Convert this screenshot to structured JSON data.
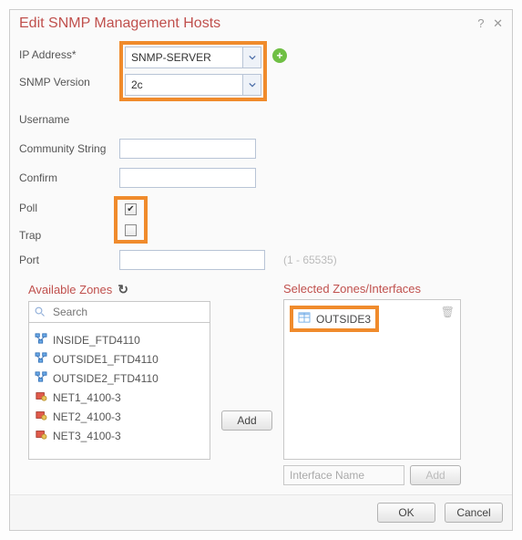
{
  "dialog": {
    "title": "Edit SNMP Management Hosts"
  },
  "form": {
    "ip_label": "IP Address*",
    "ip_value": "SNMP-SERVER",
    "version_label": "SNMP Version",
    "version_value": "2c",
    "username_label": "Username",
    "community_label": "Community String",
    "confirm_label": "Confirm",
    "poll_label": "Poll",
    "poll_checked": true,
    "trap_label": "Trap",
    "trap_checked": false,
    "port_label": "Port",
    "port_hint": "(1 - 65535)"
  },
  "zones": {
    "available_title": "Available Zones",
    "search_placeholder": "Search",
    "items": [
      {
        "name": "INSIDE_FTD4110",
        "icon": "blue"
      },
      {
        "name": "OUTSIDE1_FTD4110",
        "icon": "blue"
      },
      {
        "name": "OUTSIDE2_FTD4110",
        "icon": "blue"
      },
      {
        "name": "NET1_4100-3",
        "icon": "red"
      },
      {
        "name": "NET2_4100-3",
        "icon": "red"
      },
      {
        "name": "NET3_4100-3",
        "icon": "red"
      }
    ],
    "add_label": "Add",
    "selected_title": "Selected Zones/Interfaces",
    "selected_item": "OUTSIDE3",
    "iface_placeholder": "Interface Name",
    "iface_add_label": "Add"
  },
  "footer": {
    "ok": "OK",
    "cancel": "Cancel"
  }
}
